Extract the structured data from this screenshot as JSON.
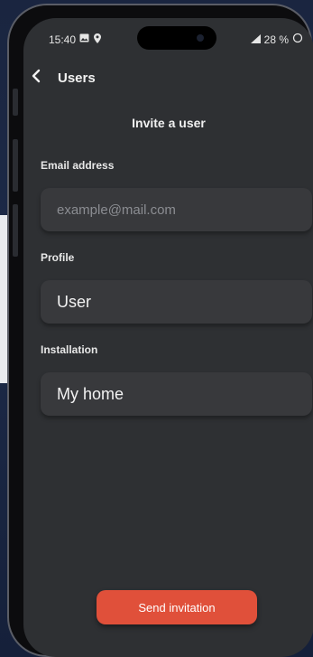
{
  "status_bar": {
    "time": "15:40",
    "battery_percent": "28 %",
    "icons": [
      "image-icon",
      "location-pin-icon",
      "signal-icon",
      "battery-ring-icon"
    ]
  },
  "nav": {
    "back_label": "Users",
    "icon": "chevron-left-icon"
  },
  "page": {
    "heading": "Invite a user"
  },
  "form": {
    "email": {
      "label": "Email address",
      "placeholder": "example@mail.com",
      "value": ""
    },
    "profile": {
      "label": "Profile",
      "value": "User"
    },
    "installation": {
      "label": "Installation",
      "value": "My home"
    }
  },
  "actions": {
    "send_label": "Send invitation"
  },
  "colors": {
    "accent": "#e0503a",
    "screen_bg": "#2e3033",
    "field_bg": "#38393c"
  }
}
